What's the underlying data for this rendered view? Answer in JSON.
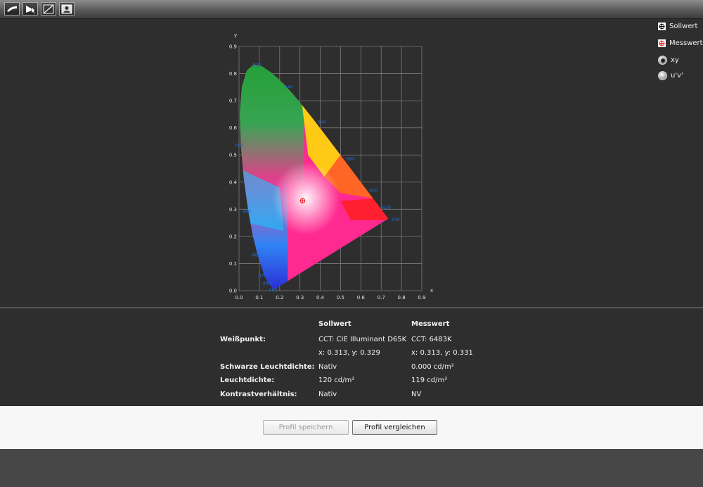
{
  "toolbar": {
    "buttons": [
      {
        "icon": "wave-icon"
      },
      {
        "icon": "play-icon"
      },
      {
        "icon": "curve-icon"
      },
      {
        "icon": "portrait-icon"
      }
    ]
  },
  "chart_data": {
    "type": "scatter",
    "title": "",
    "xlabel": "x",
    "ylabel": "y",
    "xlim": [
      0.0,
      0.9
    ],
    "ylim": [
      0.0,
      0.9
    ],
    "xticks": [
      "0.0",
      "0.1",
      "0.2",
      "0.3",
      "0.4",
      "0.5",
      "0.6",
      "0.7",
      "0.8",
      "0.9"
    ],
    "yticks": [
      "0.0",
      "0.1",
      "0.2",
      "0.3",
      "0.4",
      "0.5",
      "0.6",
      "0.7",
      "0.8",
      "0.9"
    ],
    "grid": true,
    "locus_labels": [
      {
        "text": "520",
        "x": 0.074,
        "y": 0.834
      },
      {
        "text": "540",
        "x": 0.23,
        "y": 0.754
      },
      {
        "text": "560",
        "x": 0.373,
        "y": 0.624
      },
      {
        "text": "580",
        "x": 0.512,
        "y": 0.487
      },
      {
        "text": "600",
        "x": 0.627,
        "y": 0.372
      },
      {
        "text": "620",
        "x": 0.691,
        "y": 0.308
      },
      {
        "text": "700",
        "x": 0.735,
        "y": 0.265
      },
      {
        "text": "500",
        "x": 0.008,
        "y": 0.538
      },
      {
        "text": "490",
        "x": 0.045,
        "y": 0.295
      },
      {
        "text": "480",
        "x": 0.091,
        "y": 0.133
      },
      {
        "text": "470",
        "x": 0.124,
        "y": 0.058
      },
      {
        "text": "460",
        "x": 0.144,
        "y": 0.03
      },
      {
        "text": "380",
        "x": 0.175,
        "y": 0.005
      }
    ],
    "series": [
      {
        "name": "Sollwert",
        "points": [
          [
            0.313,
            0.329
          ]
        ]
      },
      {
        "name": "Messwert",
        "points": [
          [
            0.313,
            0.331
          ]
        ]
      }
    ]
  },
  "legend": {
    "sollwert": "Sollwert",
    "messwert": "Messwert"
  },
  "space_options": [
    {
      "label": "xy",
      "checked": true
    },
    {
      "label": "u'v'",
      "checked": false
    }
  ],
  "table": {
    "headers": {
      "target": "Sollwert",
      "measured": "Messwert"
    },
    "rows": [
      {
        "label": "Weißpunkt:",
        "target": "CCT: CIE Illuminant D65K",
        "measured": "CCT: 6483K"
      },
      {
        "label": "",
        "target": "x: 0.313, y: 0.329",
        "measured": "x: 0.313, y: 0.331"
      },
      {
        "label": "Schwarze Leuchtdichte:",
        "target": "Nativ",
        "measured": "0.000 cd/m²"
      },
      {
        "label": "Leuchtdichte:",
        "target": "120 cd/m²",
        "measured": "119 cd/m²"
      },
      {
        "label": "Kontrastverhältnis:",
        "target": "Nativ",
        "measured": "NV"
      }
    ]
  },
  "footer": {
    "save_label": "Profil speichern",
    "compare_label": "Profil vergleichen"
  },
  "colors": {
    "tick_label": "#1f6fd6",
    "marker": "#e01010",
    "background": "#2e2e2e"
  }
}
